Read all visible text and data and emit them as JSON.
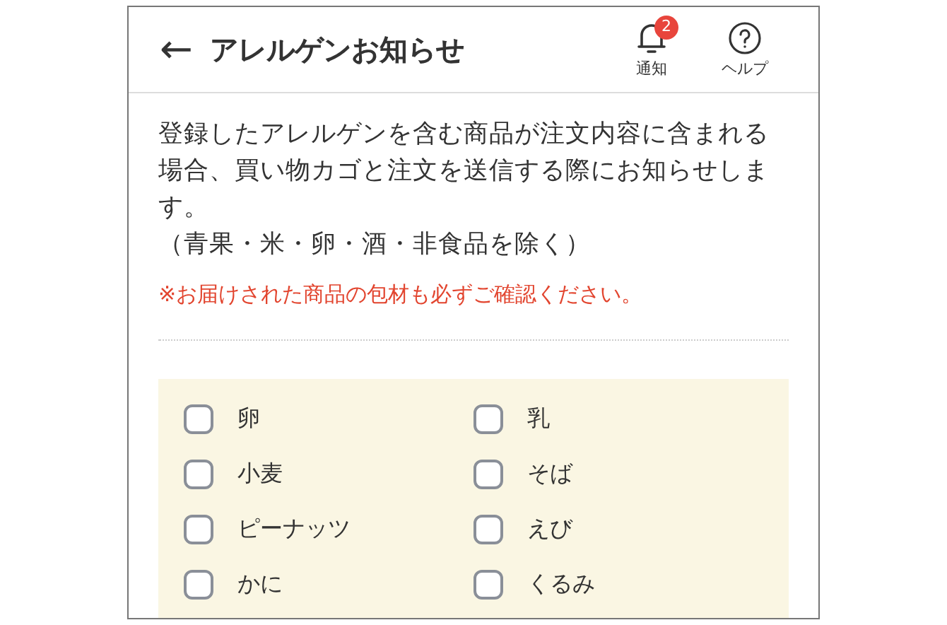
{
  "header": {
    "back": "←",
    "title": "アレルゲンお知らせ",
    "actions": [
      {
        "kind": "bell",
        "label": "通知",
        "badge": "2"
      },
      {
        "kind": "help",
        "label": "ヘルプ"
      }
    ]
  },
  "description": "登録したアレルゲンを含む商品が注文内容に含まれる場合、買い物カゴと注文を送信する際にお知らせします。",
  "exclusion": "（青果・米・卵・酒・非食品を除く）",
  "warning": "※お届けされた商品の包材も必ずご確認ください。",
  "allergens": [
    {
      "label": "卵",
      "checked": false
    },
    {
      "label": "乳",
      "checked": false
    },
    {
      "label": "小麦",
      "checked": false
    },
    {
      "label": "そば",
      "checked": false
    },
    {
      "label": "ピーナッツ",
      "checked": false
    },
    {
      "label": "えび",
      "checked": false
    },
    {
      "label": "かに",
      "checked": false
    },
    {
      "label": "くるみ",
      "checked": false
    }
  ]
}
